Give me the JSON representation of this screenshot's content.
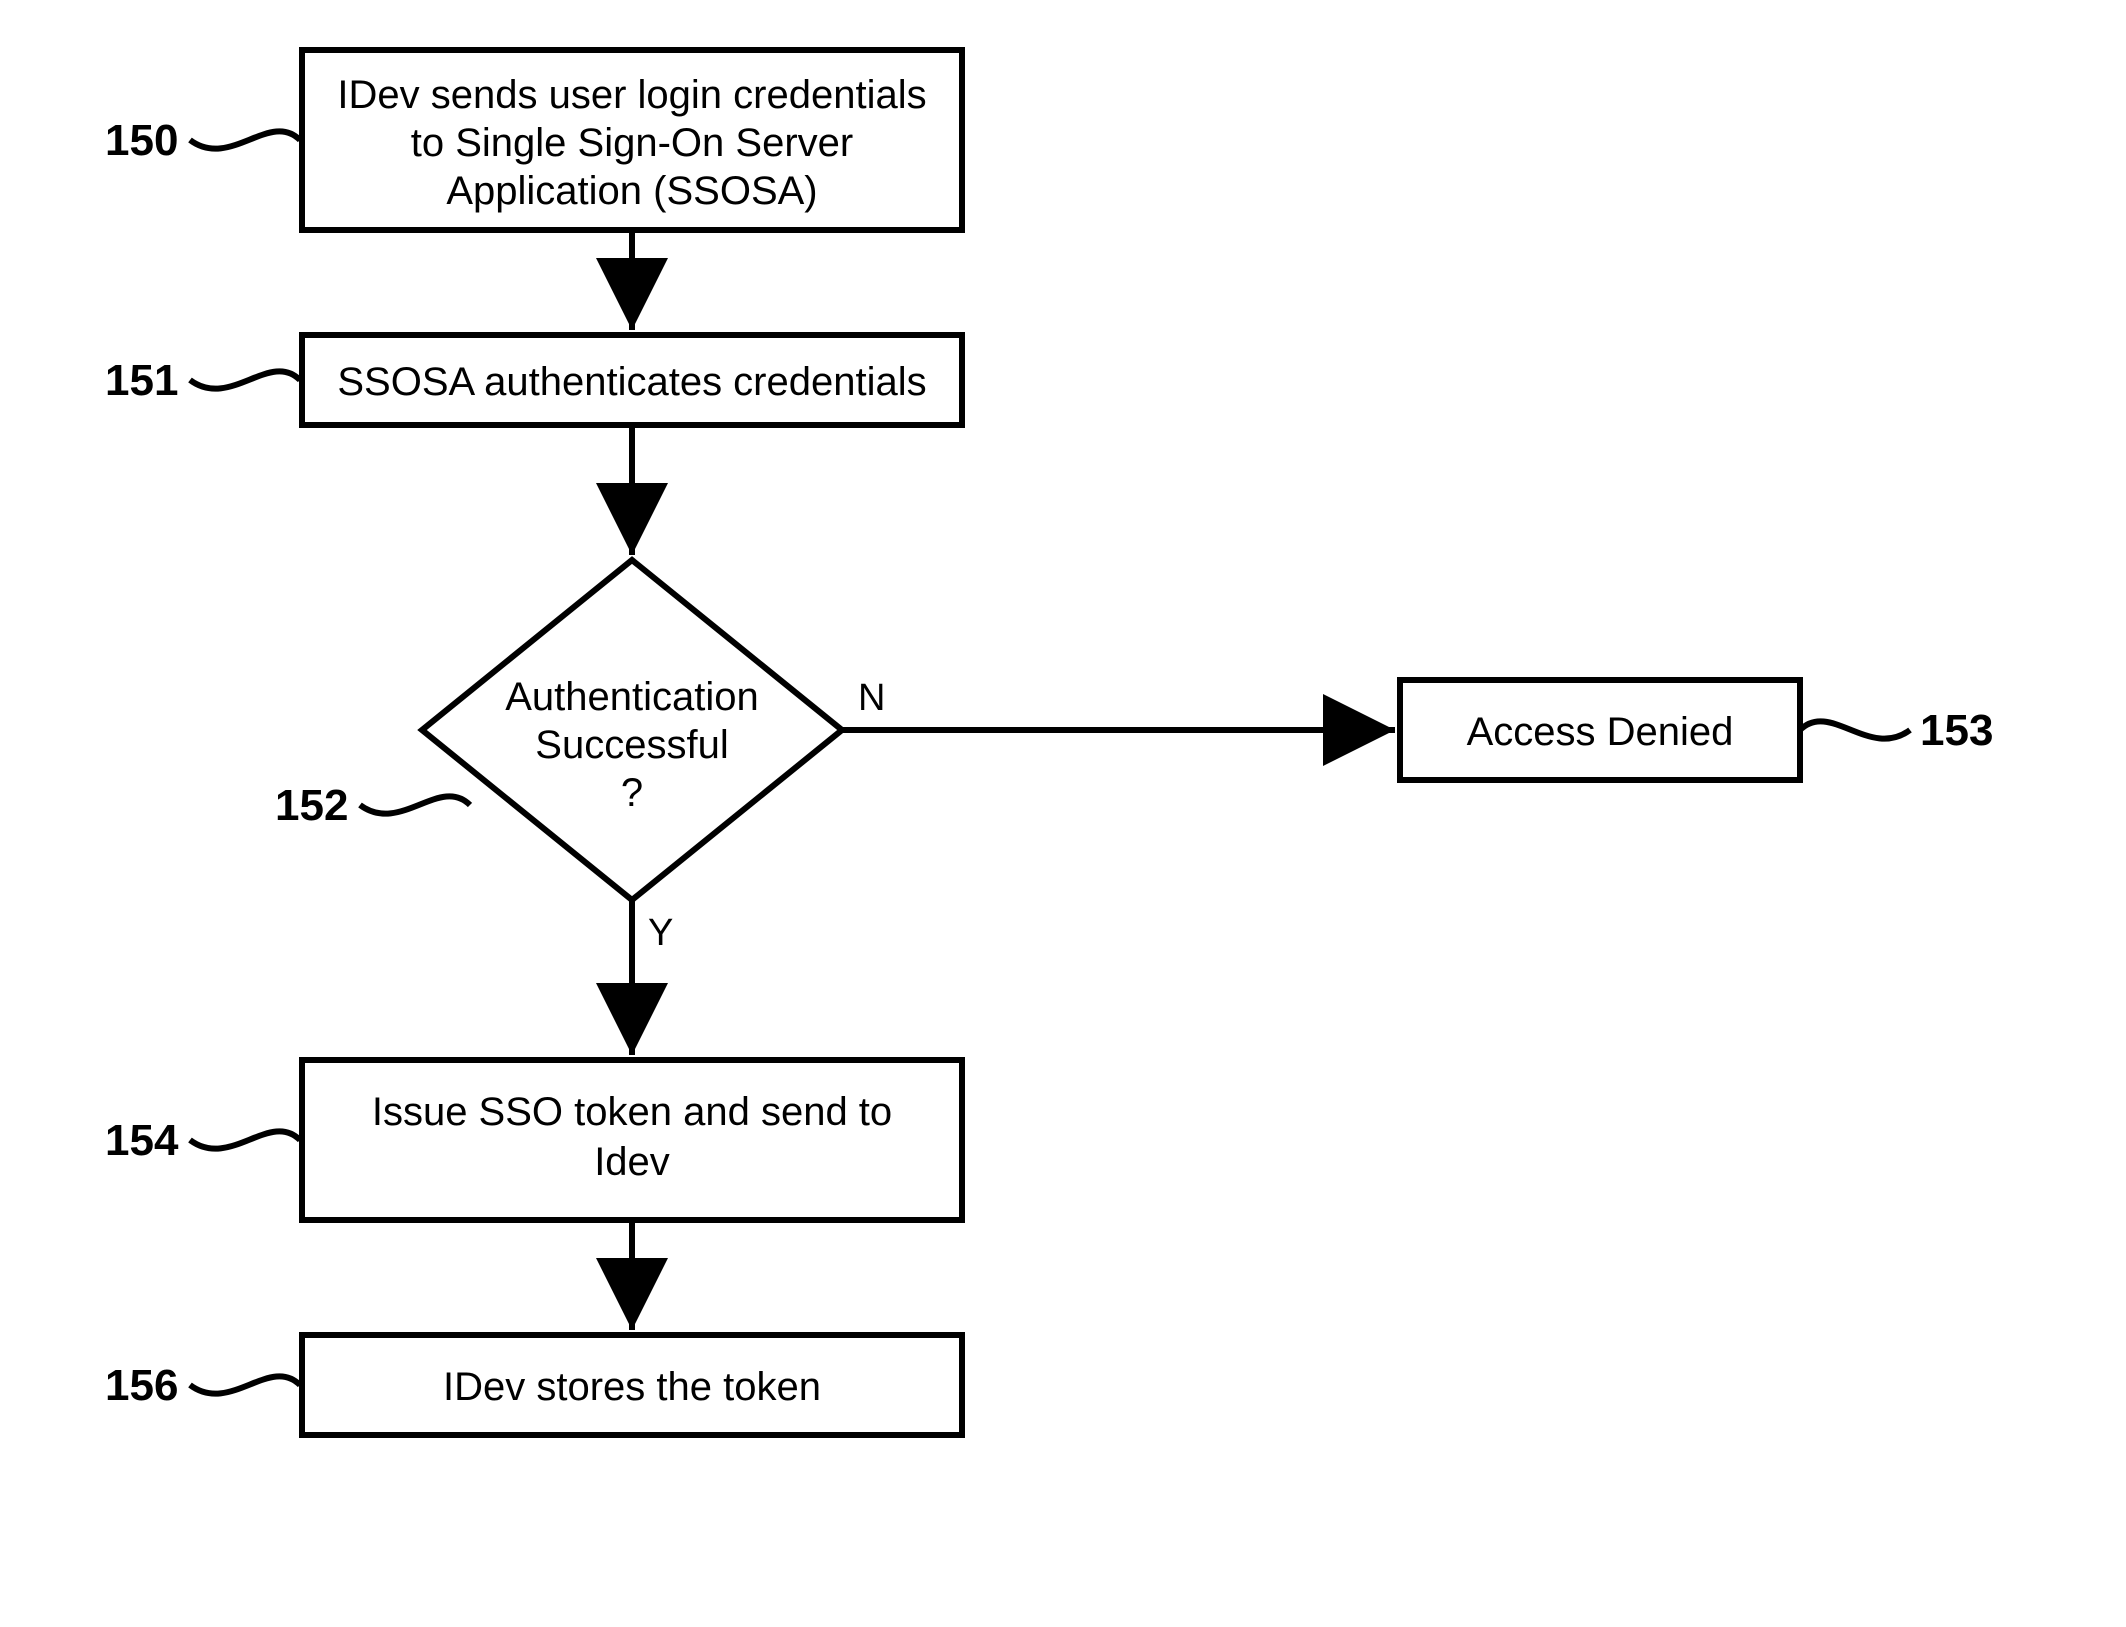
{
  "nodes": {
    "n150": {
      "ref": "150",
      "lines": [
        "IDev sends user login credentials",
        "to Single Sign-On Server",
        "Application (SSOSA)"
      ]
    },
    "n151": {
      "ref": "151",
      "lines": [
        "SSOSA authenticates credentials"
      ]
    },
    "n152": {
      "ref": "152",
      "lines": [
        "Authentication",
        "Successful",
        "?"
      ]
    },
    "n153": {
      "ref": "153",
      "lines": [
        "Access Denied"
      ]
    },
    "n154": {
      "ref": "154",
      "lines": [
        "Issue SSO token and send to",
        "Idev"
      ]
    },
    "n156": {
      "ref": "156",
      "lines": [
        "IDev stores the token"
      ]
    }
  },
  "branches": {
    "no": "N",
    "yes": "Y"
  }
}
